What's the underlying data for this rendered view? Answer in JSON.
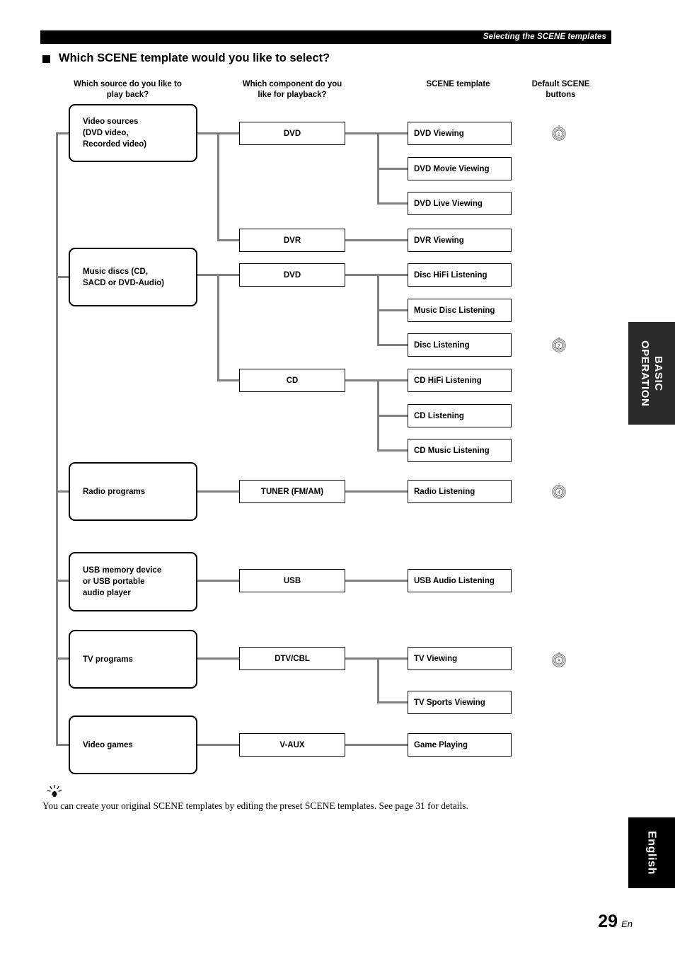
{
  "header": {
    "running_title": "Selecting the SCENE templates"
  },
  "section": {
    "title": "Which SCENE template would you like to select?"
  },
  "columns": {
    "source": "Which source do you like to\nplay back?",
    "source_line1": "Which source do you like to",
    "source_line2": "play back?",
    "component_line1": "Which component do you",
    "component_line2": "like for playback?",
    "template": "SCENE template",
    "buttons_line1": "Default SCENE",
    "buttons_line2": "buttons"
  },
  "diagram": {
    "sources": [
      {
        "id": "video-sources",
        "lines": [
          "Video sources",
          "(DVD video,",
          "Recorded video)"
        ]
      },
      {
        "id": "music-discs",
        "lines": [
          "Music discs (CD,",
          "SACD or DVD-Audio)"
        ]
      },
      {
        "id": "radio-programs",
        "lines": [
          "Radio programs"
        ]
      },
      {
        "id": "usb-device",
        "lines": [
          "USB memory device",
          "or USB portable",
          "audio player"
        ]
      },
      {
        "id": "tv-programs",
        "lines": [
          "TV programs"
        ]
      },
      {
        "id": "video-games",
        "lines": [
          "Video games"
        ]
      }
    ],
    "components": [
      {
        "id": "dvd-video",
        "label": "DVD"
      },
      {
        "id": "dvr",
        "label": "DVR"
      },
      {
        "id": "dvd-audio",
        "label": "DVD"
      },
      {
        "id": "cd",
        "label": "CD"
      },
      {
        "id": "tuner",
        "label": "TUNER (FM/AM)"
      },
      {
        "id": "usb",
        "label": "USB"
      },
      {
        "id": "dtv-cbl",
        "label": "DTV/CBL"
      },
      {
        "id": "v-aux",
        "label": "V-AUX"
      }
    ],
    "templates": [
      {
        "id": "dvd-viewing",
        "label": "DVD Viewing"
      },
      {
        "id": "dvd-movie-viewing",
        "label": "DVD Movie Viewing"
      },
      {
        "id": "dvd-live-viewing",
        "label": "DVD Live Viewing"
      },
      {
        "id": "dvr-viewing",
        "label": "DVR Viewing"
      },
      {
        "id": "disc-hifi-listening",
        "label": "Disc HiFi Listening"
      },
      {
        "id": "music-disc-listening",
        "label": "Music Disc Listening"
      },
      {
        "id": "disc-listening",
        "label": "Disc Listening"
      },
      {
        "id": "cd-hifi-listening",
        "label": "CD HiFi Listening"
      },
      {
        "id": "cd-listening",
        "label": "CD Listening"
      },
      {
        "id": "cd-music-listening",
        "label": "CD Music Listening"
      },
      {
        "id": "radio-listening",
        "label": "Radio Listening"
      },
      {
        "id": "usb-audio-listening",
        "label": "USB Audio Listening"
      },
      {
        "id": "tv-viewing",
        "label": "TV Viewing"
      },
      {
        "id": "tv-sports-viewing",
        "label": "TV Sports Viewing"
      },
      {
        "id": "game-playing",
        "label": "Game Playing"
      }
    ],
    "scene_buttons": [
      {
        "id": "scene-button-1",
        "number": "1",
        "for_template": "DVD Viewing"
      },
      {
        "id": "scene-button-2",
        "number": "2",
        "for_template": "Disc Listening"
      },
      {
        "id": "scene-button-4",
        "number": "4",
        "for_template": "Radio Listening"
      },
      {
        "id": "scene-button-3",
        "number": "3",
        "for_template": "TV Viewing"
      }
    ]
  },
  "tip": {
    "icon": "tip-bulb-icon",
    "text": "You can create your original SCENE templates by editing the preset SCENE templates. See page 31 for details."
  },
  "side_tabs": {
    "basic_operation": "BASIC OPERATION",
    "english": "English"
  },
  "footer": {
    "page_number": "29",
    "language_code": "En"
  },
  "colors": {
    "line": "#808080",
    "box_border": "#000000",
    "header_bar": "#000000",
    "tab_basic_bg": "#2b2b2b",
    "tab_english_bg": "#000000"
  }
}
